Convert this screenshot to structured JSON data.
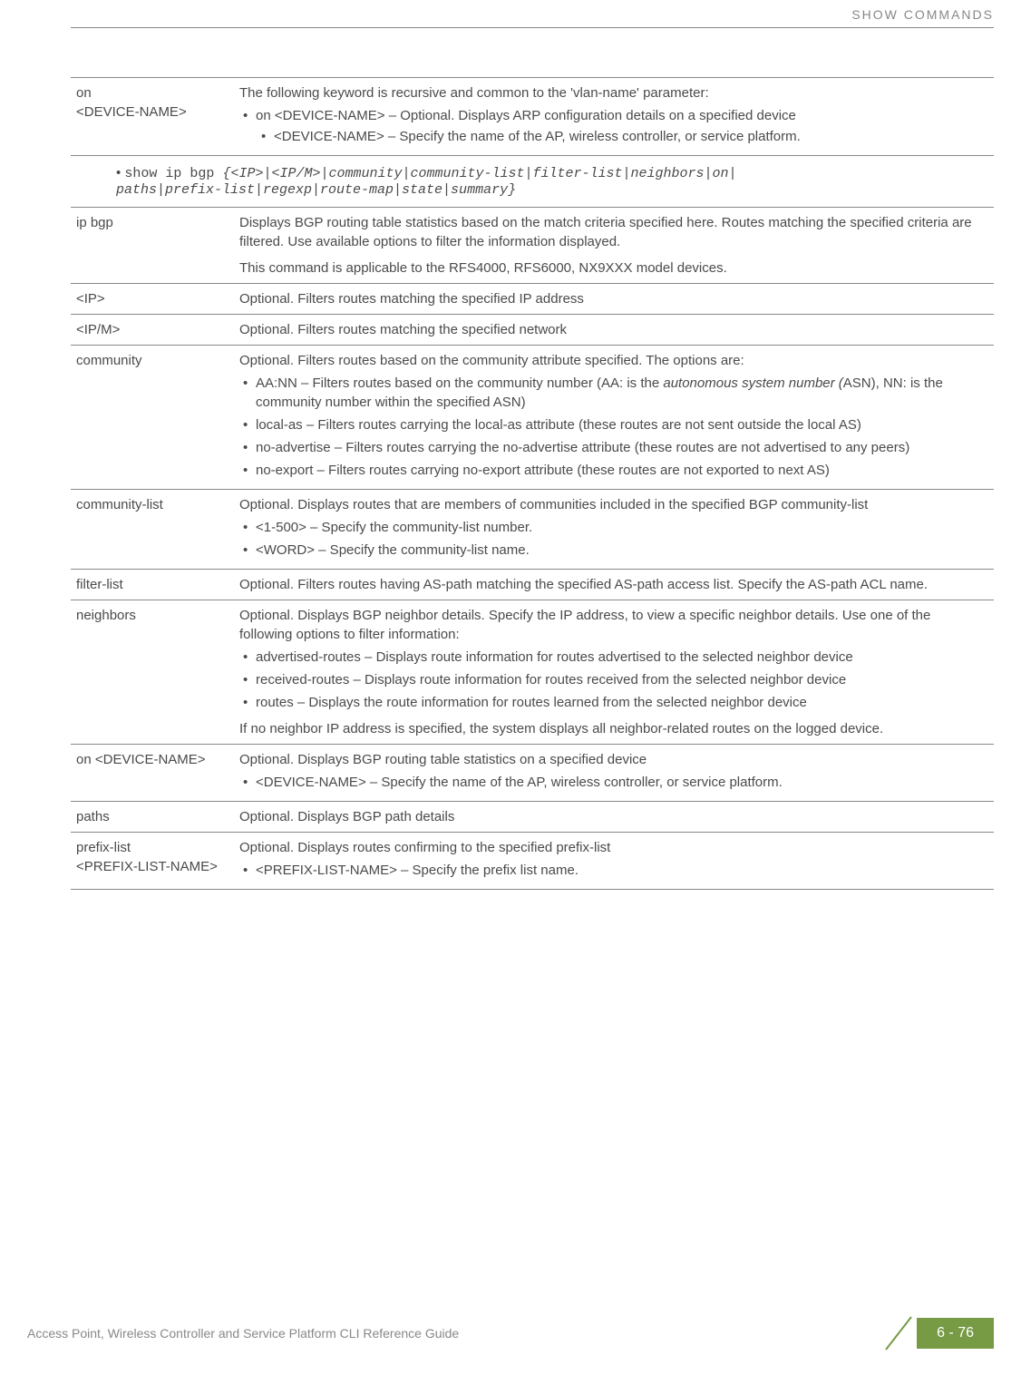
{
  "header": {
    "section_title": "SHOW COMMANDS"
  },
  "table1": {
    "row1": {
      "col1_line1": "on",
      "col1_line2": "<DEVICE-NAME>",
      "intro": "The following keyword is recursive and common to the 'vlan-name' parameter:",
      "li1": "on <DEVICE-NAME> – Optional. Displays ARP configuration details on a specified device",
      "li1_sub1": "<DEVICE-NAME> – Specify the name of the AP, wireless controller, or service platform."
    }
  },
  "command_block": {
    "prefix": "• ",
    "cmd": "show ip bgp ",
    "args_line1": "{<IP>|<IP/M>|community|community-list|filter-list|neighbors|on|",
    "args_line2": "paths|prefix-list|regexp|route-map|state|summary}"
  },
  "table2": {
    "row_ipbgp": {
      "col1": "ip bgp",
      "p1": "Displays BGP routing table statistics based on the match criteria specified here. Routes matching the specified criteria are filtered. Use available options to filter the information displayed.",
      "p2": "This command is applicable to the RFS4000, RFS6000, NX9XXX model devices."
    },
    "row_ip": {
      "col1": "<IP>",
      "p1": "Optional. Filters routes matching the specified IP address"
    },
    "row_ipm": {
      "col1": "<IP/M>",
      "p1": "Optional. Filters routes matching the specified network"
    },
    "row_community": {
      "col1": "community",
      "p1": "Optional. Filters routes based on the community attribute specified. The options are:",
      "li1a": "AA:NN – Filters routes based on the community number (AA: is the ",
      "li1_italic": "autonomous system number (",
      "li1b": "ASN), NN: is the community number within the specified ASN)",
      "li2": "local-as – Filters routes carrying the local-as attribute (these routes are not sent outside the local AS)",
      "li3": "no-advertise – Filters routes carrying the no-advertise attribute (these routes are not advertised to any peers)",
      "li4": "no-export – Filters routes carrying no-export attribute (these routes are not exported to next AS)"
    },
    "row_communitylist": {
      "col1": "community-list",
      "p1": "Optional. Displays routes that are members of communities included in the specified BGP community-list",
      "li1": "<1-500> – Specify the community-list number.",
      "li2": "<WORD> – Specify the community-list name."
    },
    "row_filterlist": {
      "col1": "filter-list",
      "p1": "Optional. Filters routes having AS-path matching the specified AS-path access list. Specify the AS-path ACL name."
    },
    "row_neighbors": {
      "col1": "neighbors",
      "p1": "Optional. Displays BGP neighbor details. Specify the IP address, to view a specific neighbor details. Use one of the following options to filter information:",
      "li1": "advertised-routes – Displays route information for routes advertised to the selected neighbor device",
      "li2": "received-routes – Displays route information for routes received from the selected neighbor device",
      "li3": "routes – Displays the route information for routes learned from the selected neighbor device",
      "p2": "If no neighbor IP address is specified, the system displays all neighbor-related routes on the logged device."
    },
    "row_ondevice": {
      "col1": "on <DEVICE-NAME>",
      "p1": "Optional. Displays BGP routing table statistics on a specified device",
      "li1": "<DEVICE-NAME> – Specify the name of the AP, wireless controller, or service platform."
    },
    "row_paths": {
      "col1": "paths",
      "p1": "Optional. Displays BGP path details"
    },
    "row_prefixlist": {
      "col1_line1": "prefix-list",
      "col1_line2": "<PREFIX-LIST-NAME>",
      "p1": "Optional. Displays routes confirming to the specified prefix-list",
      "li1": "<PREFIX-LIST-NAME> – Specify the prefix list name."
    }
  },
  "footer": {
    "text": "Access Point, Wireless Controller and Service Platform CLI Reference Guide",
    "page": "6 - 76"
  }
}
